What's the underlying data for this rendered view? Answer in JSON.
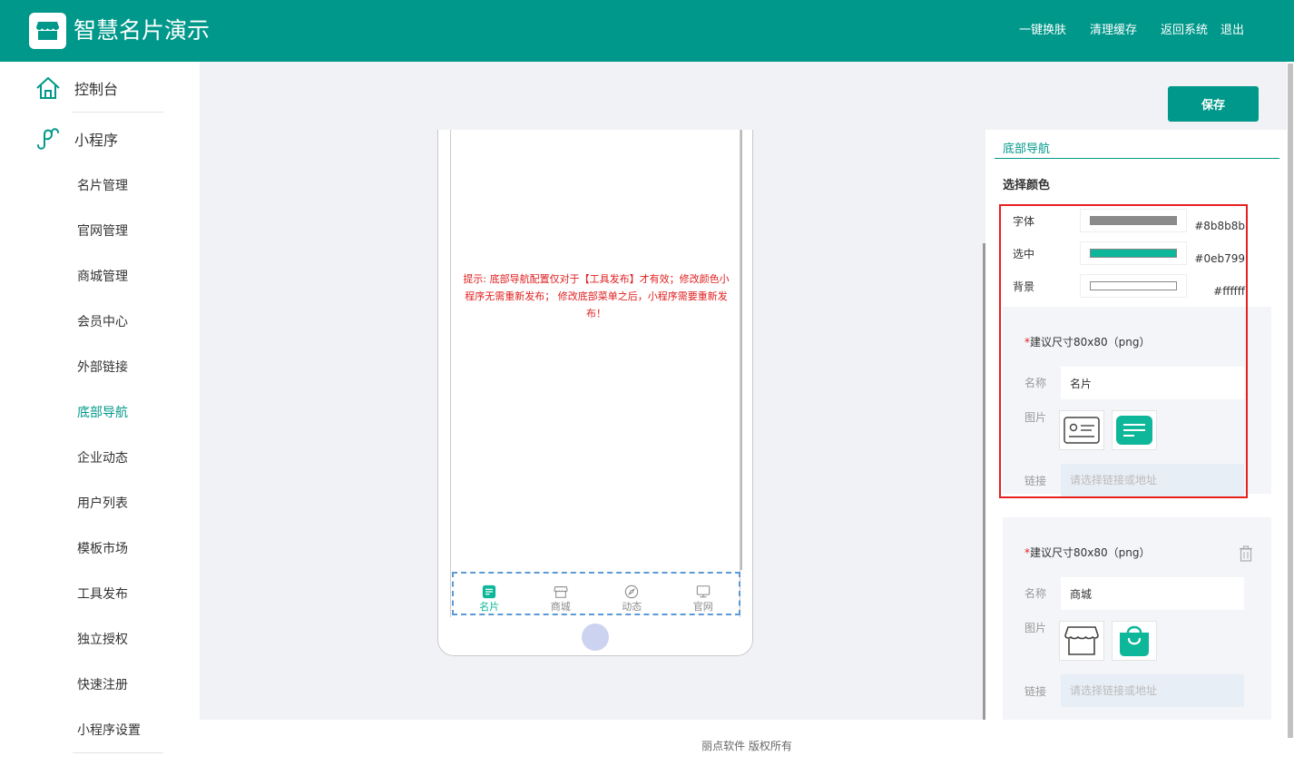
{
  "app": {
    "title": "智慧名片演示"
  },
  "header": {
    "links": [
      "一键换肤",
      "清理缓存",
      "返回系统",
      "退出"
    ]
  },
  "sidebar": {
    "groups": [
      {
        "label": "控制台",
        "icon": "home-icon"
      },
      {
        "label": "小程序",
        "icon": "mini-program-icon"
      }
    ],
    "items": [
      {
        "label": "名片管理"
      },
      {
        "label": "官网管理"
      },
      {
        "label": "商城管理"
      },
      {
        "label": "会员中心"
      },
      {
        "label": "外部链接"
      },
      {
        "label": "底部导航",
        "active": true
      },
      {
        "label": "企业动态"
      },
      {
        "label": "用户列表"
      },
      {
        "label": "模板市场"
      },
      {
        "label": "工具发布"
      },
      {
        "label": "独立授权"
      },
      {
        "label": "快速注册"
      },
      {
        "label": "小程序设置"
      }
    ]
  },
  "toolbar": {
    "save_label": "保存"
  },
  "phone": {
    "tip": "提示: 底部导航配置仅对于【工具发布】才有效；修改颜色小程序无需重新发布； 修改底部菜单之后，小程序需要重新发布！",
    "tabs": [
      {
        "label": "名片",
        "icon": "card-icon",
        "selected": true
      },
      {
        "label": "商城",
        "icon": "shop-icon",
        "selected": false
      },
      {
        "label": "动态",
        "icon": "compass-icon",
        "selected": false
      },
      {
        "label": "官网",
        "icon": "monitor-icon",
        "selected": false
      }
    ]
  },
  "panel": {
    "tab_label": "底部导航",
    "section_title": "选择颜色",
    "colors": [
      {
        "label": "字体",
        "value": "#8b8b8b"
      },
      {
        "label": "选中",
        "value": "#0eb799"
      },
      {
        "label": "背景",
        "value": "#ffffff"
      }
    ],
    "nav_items": [
      {
        "hint": "建议尺寸80x80（png）",
        "name_label": "名称",
        "name_value": "名片",
        "image_label": "图片",
        "link_label": "链接",
        "link_placeholder": "请选择链接或地址"
      },
      {
        "hint": "建议尺寸80x80（png）",
        "name_label": "名称",
        "name_value": "商城",
        "image_label": "图片",
        "link_label": "链接",
        "link_placeholder": "请选择链接或地址"
      }
    ]
  },
  "footer": {
    "text": "丽点软件 版权所有"
  },
  "colors": {
    "brand": "#00988a",
    "tab_font": "#8b8b8b",
    "tab_selected": "#0eb799",
    "tip": "#e02020"
  }
}
